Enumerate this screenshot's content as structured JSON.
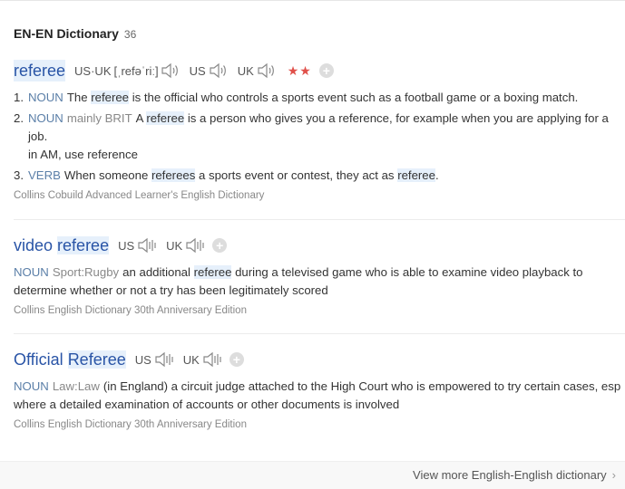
{
  "header": {
    "title": "EN-EN Dictionary",
    "count": "36"
  },
  "entries": [
    {
      "headword": "referee",
      "pron_us_uk_label": "US·UK",
      "phonetic": "[ˌrefəˈriː]",
      "us_label": "US",
      "uk_label": "UK",
      "stars": "★★",
      "add_label": "+",
      "senses": [
        {
          "num": "1.",
          "pos": "NOUN",
          "parts": [
            "The ",
            "referee",
            " is the official who controls a sports event such as a football game or a boxing match."
          ]
        },
        {
          "num": "2.",
          "pos": "NOUN",
          "domain": "mainly BRIT",
          "parts": [
            "A ",
            "referee",
            " is a person who gives you a reference, for example when you are applying for a job."
          ],
          "note": "in AM, use reference"
        },
        {
          "num": "3.",
          "pos": "VERB",
          "parts": [
            "When someone ",
            "referees",
            " a sports event or contest, they act as ",
            "referee",
            "."
          ]
        }
      ],
      "source": "Collins Cobuild Advanced Learner's English Dictionary"
    },
    {
      "headword_part1": "video ",
      "headword_part2": "referee",
      "us_label": "US",
      "uk_label": "UK",
      "add_label": "+",
      "pos": "NOUN",
      "domain": "Sport:Rugby",
      "parts": [
        "an additional ",
        "referee",
        " during a televised game who is able to examine video playback to determine whether or not a try has been legitimately scored"
      ],
      "source": "Collins English Dictionary 30th Anniversary Edition"
    },
    {
      "headword_part1": "Official ",
      "headword_part2": "Referee",
      "us_label": "US",
      "uk_label": "UK",
      "add_label": "+",
      "pos": "NOUN",
      "domain": "Law:Law",
      "definition": "(in England) a circuit judge attached to the High Court who is empowered to try certain cases, esp where a detailed examination of accounts or other documents is involved",
      "source": "Collins English Dictionary 30th Anniversary Edition"
    }
  ],
  "footer": {
    "view_more": "View more English-English dictionary",
    "chevron": "›"
  },
  "colors": {
    "headword": "#2954a6",
    "pos": "#5b7fa8",
    "stars": "#e0504a",
    "highlight": "#e6f0fb"
  },
  "icons": {
    "speaker": "speaker-icon",
    "add": "plus-circle-icon",
    "chevron": "chevron-right-icon"
  }
}
